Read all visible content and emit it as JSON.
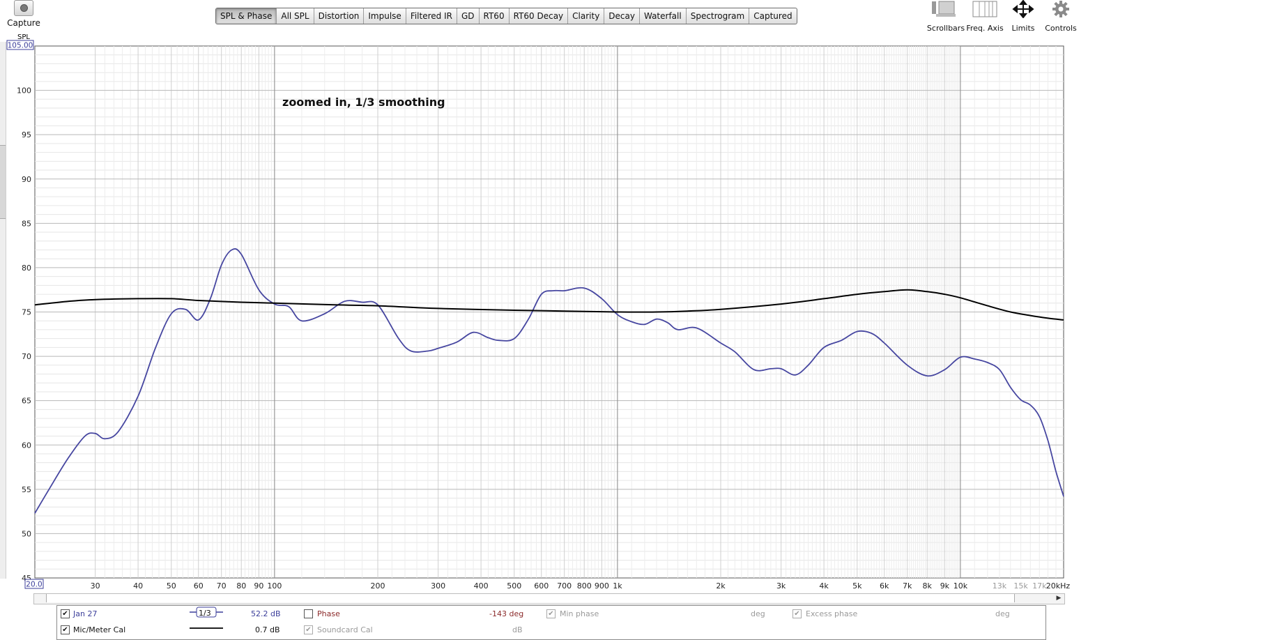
{
  "capture": {
    "label": "Capture",
    "icon": "camera-icon"
  },
  "tabs": [
    "SPL & Phase",
    "All SPL",
    "Distortion",
    "Impulse",
    "Filtered IR",
    "GD",
    "RT60",
    "RT60 Decay",
    "Clarity",
    "Decay",
    "Waterfall",
    "Spectrogram",
    "Captured"
  ],
  "active_tab": "SPL & Phase",
  "tools": [
    {
      "label": "Scrollbars",
      "icon": "scrollbars-icon"
    },
    {
      "label": "Freq. Axis",
      "icon": "freq-axis-icon"
    },
    {
      "label": "Limits",
      "icon": "limits-icon"
    },
    {
      "label": "Controls",
      "icon": "gear-icon"
    }
  ],
  "plot": {
    "annotation": "zoomed in, 1/3 smoothing",
    "y_title": "SPL",
    "y_max_box": "105.00",
    "x_min_box": "20.0",
    "y_ticks": [
      "100",
      "95",
      "90",
      "85",
      "80",
      "75",
      "70",
      "65",
      "60",
      "55",
      "50",
      "45"
    ],
    "x_ticks": [
      "30",
      "40",
      "50",
      "60",
      "70",
      "80",
      "90",
      "100",
      "200",
      "300",
      "400",
      "500",
      "600",
      "700",
      "800",
      "900",
      "1k",
      "2k",
      "3k",
      "4k",
      "5k",
      "6k",
      "7k",
      "8k",
      "9k",
      "10k",
      "13k",
      "15k",
      "17k",
      "20kHz"
    ]
  },
  "chart_data": {
    "type": "line",
    "x_scale": "log",
    "xlim": [
      20,
      20000
    ],
    "ylim": [
      45,
      105
    ],
    "xlabel": "",
    "ylabel": "SPL",
    "grid": true,
    "series": [
      {
        "name": "Jan 27",
        "color": "#4646a0",
        "x": [
          20,
          22,
          25,
          28,
          30,
          32,
          35,
          40,
          45,
          50,
          55,
          60,
          65,
          70,
          75,
          80,
          90,
          100,
          110,
          120,
          140,
          160,
          180,
          200,
          230,
          250,
          280,
          300,
          340,
          380,
          420,
          450,
          500,
          550,
          600,
          650,
          700,
          800,
          900,
          1000,
          1100,
          1200,
          1300,
          1400,
          1500,
          1700,
          2000,
          2200,
          2500,
          2800,
          3000,
          3300,
          3600,
          4000,
          4500,
          5000,
          5500,
          6000,
          7000,
          8000,
          9000,
          10000,
          11000,
          12000,
          13000,
          14000,
          15000,
          16000,
          17000,
          18000,
          19000,
          20000
        ],
        "values": [
          52.3,
          55.0,
          58.5,
          61.0,
          61.3,
          60.7,
          61.5,
          65.5,
          71.0,
          74.8,
          75.3,
          74.1,
          76.5,
          80.3,
          82.0,
          81.5,
          77.5,
          75.9,
          75.6,
          74.0,
          74.8,
          76.2,
          76.1,
          75.8,
          72.0,
          70.6,
          70.6,
          70.9,
          71.6,
          72.7,
          72.1,
          71.8,
          72.0,
          74.2,
          77.0,
          77.4,
          77.4,
          77.7,
          76.5,
          74.7,
          73.9,
          73.6,
          74.2,
          73.8,
          73.0,
          73.2,
          71.5,
          70.5,
          68.5,
          68.6,
          68.6,
          67.9,
          69.0,
          71.0,
          71.8,
          72.8,
          72.6,
          71.5,
          69.0,
          67.8,
          68.5,
          69.9,
          69.7,
          69.3,
          68.5,
          66.5,
          65.1,
          64.5,
          63.2,
          60.5,
          57.0,
          54.2
        ]
      },
      {
        "name": "Mic/Meter Cal",
        "color": "#000000",
        "x": [
          20,
          25,
          30,
          40,
          50,
          60,
          80,
          100,
          150,
          200,
          300,
          500,
          700,
          1000,
          1300,
          1600,
          2000,
          3000,
          4000,
          5000,
          6000,
          7000,
          8000,
          9000,
          10000,
          12000,
          14000,
          16000,
          18000,
          20000
        ],
        "values": [
          75.8,
          76.2,
          76.4,
          76.5,
          76.5,
          76.3,
          76.1,
          76.0,
          75.8,
          75.7,
          75.4,
          75.2,
          75.1,
          75.0,
          75.0,
          75.1,
          75.3,
          75.9,
          76.5,
          77.0,
          77.3,
          77.5,
          77.3,
          77.0,
          76.6,
          75.7,
          75.0,
          74.6,
          74.3,
          74.1
        ]
      }
    ]
  },
  "legend": {
    "rows": [
      {
        "checked": true,
        "name": "Jan 27",
        "smoothing": "1/3",
        "value": "52.2 dB",
        "phase": {
          "label": "Phase",
          "checked": false,
          "value": "-143 deg"
        },
        "min_phase": {
          "label": "Min phase",
          "checked": true,
          "unit": "deg"
        },
        "excess_phase": {
          "label": "Excess phase",
          "checked": true,
          "unit": "deg"
        }
      },
      {
        "checked": true,
        "name": "Mic/Meter Cal",
        "value": "0.7 dB",
        "soundcard": {
          "label": "Soundcard Cal",
          "checked": true,
          "unit": "dB"
        }
      }
    ]
  }
}
